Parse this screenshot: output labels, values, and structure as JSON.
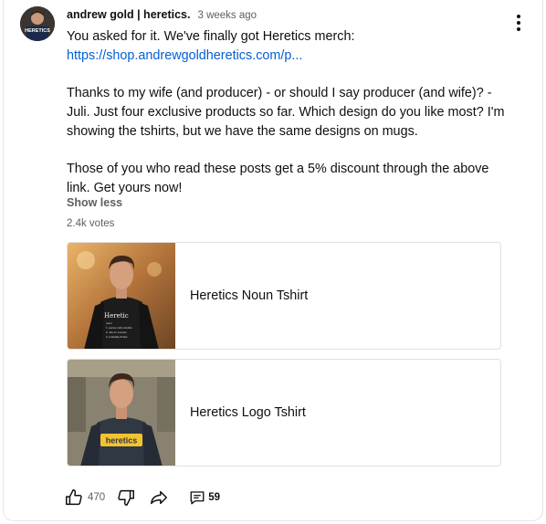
{
  "post": {
    "author": "andrew gold | heretics.",
    "time": "3 weeks ago",
    "avatar_text": "HERETICS",
    "line1": "You asked for it. We've finally got Heretics merch:",
    "link": "https://shop.andrewgoldheretics.com/p...",
    "para2": "Thanks to my wife (and producer) - or should I say producer (and wife)? - Juli. Just four exclusive products so far. Which design do you like most? I'm showing the tshirts, but we have the same designs on mugs.",
    "para3": "Those of you who read these posts get a 5% discount through the above link. Get yours now!",
    "show_less": "Show less",
    "votes": "2.4k votes"
  },
  "poll": {
    "options": [
      {
        "label": "Heretics Noun Tshirt",
        "shirt_title": "Heretic",
        "shirt_lines": [
          "noun",
          "1. person who doubts",
          "2. sits on a fence",
          "3. probably thinks"
        ]
      },
      {
        "label": "Heretics Logo Tshirt",
        "shirt_title": "heretics"
      }
    ]
  },
  "actions": {
    "like_count": "470",
    "comment_count": "59"
  },
  "icons": {
    "menu": "more-vertical-icon",
    "like": "thumbs-up-icon",
    "dislike": "thumbs-down-icon",
    "share": "share-icon",
    "comment": "comment-icon"
  },
  "colors": {
    "link": "#065fd4",
    "secondary_text": "#606060",
    "logo_yellow": "#f2c230"
  }
}
